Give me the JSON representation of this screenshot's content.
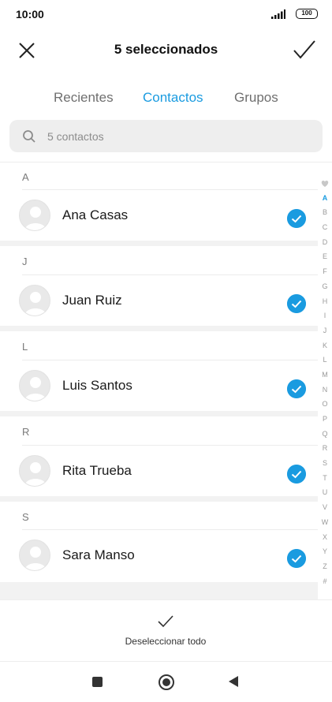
{
  "status": {
    "time": "10:00",
    "battery": "100"
  },
  "header": {
    "title": "5 seleccionados"
  },
  "tabs": [
    {
      "label": "Recientes"
    },
    {
      "label": "Contactos"
    },
    {
      "label": "Grupos"
    }
  ],
  "search": {
    "placeholder": "5 contactos"
  },
  "sections": [
    {
      "letter": "A",
      "contact": "Ana Casas"
    },
    {
      "letter": "J",
      "contact": "Juan Ruiz"
    },
    {
      "letter": "L",
      "contact": "Luis Santos"
    },
    {
      "letter": "R",
      "contact": "Rita Trueba"
    },
    {
      "letter": "S",
      "contact": "Sara Manso"
    }
  ],
  "alphabet_index": [
    "A",
    "B",
    "C",
    "D",
    "E",
    "F",
    "G",
    "H",
    "I",
    "J",
    "K",
    "L",
    "M",
    "N",
    "O",
    "P",
    "Q",
    "R",
    "S",
    "T",
    "U",
    "V",
    "W",
    "X",
    "Y",
    "Z",
    "#"
  ],
  "footer": {
    "deselect_label": "Deseleccionar todo"
  },
  "colors": {
    "accent": "#1a9be0"
  }
}
